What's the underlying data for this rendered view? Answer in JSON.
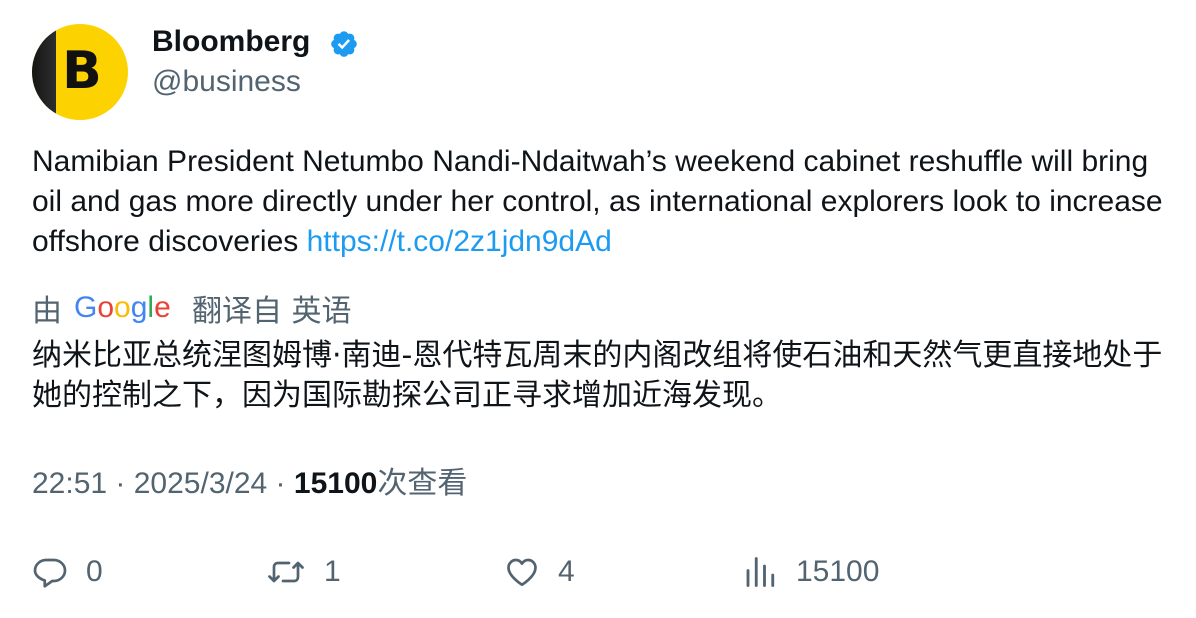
{
  "author": {
    "name": "Bloomberg",
    "handle": "@business",
    "avatar_letter": "B",
    "avatar_color": "#fcd200",
    "verified": true,
    "verified_icon": "verified-badge-icon",
    "verified_color": "#1d9bf0"
  },
  "tweet": {
    "text": "Namibian President Netumbo Nandi-Ndaitwah’s weekend cabinet reshuffle will bring oil and gas more directly under her control, as international explorers look to increase offshore discoveries ",
    "link": "https://t.co/2z1jdn9dAd",
    "link_color": "#1d9bf0"
  },
  "translation": {
    "prefix": "由",
    "provider": "Google",
    "suffix": "翻译自 英语",
    "text": "纳米比亚总统涅图姆博·南迪-恩代特瓦周末的内阁改组将使石油和天然气更直接地处于她的控制之下，因为国际勘探公司正寻求增加近海发现。"
  },
  "meta": {
    "time": "22:51",
    "separator": " · ",
    "date": "2025/3/24",
    "views_count": "15100",
    "views_label": "次查看"
  },
  "actions": {
    "reply": {
      "icon": "reply-icon",
      "count": "0"
    },
    "retweet": {
      "icon": "retweet-icon",
      "count": "1"
    },
    "like": {
      "icon": "heart-icon",
      "count": "4"
    },
    "views": {
      "icon": "views-icon",
      "count": "15100"
    }
  },
  "colors": {
    "text_primary": "#0f1419",
    "text_secondary": "#536471",
    "link": "#1d9bf0"
  }
}
